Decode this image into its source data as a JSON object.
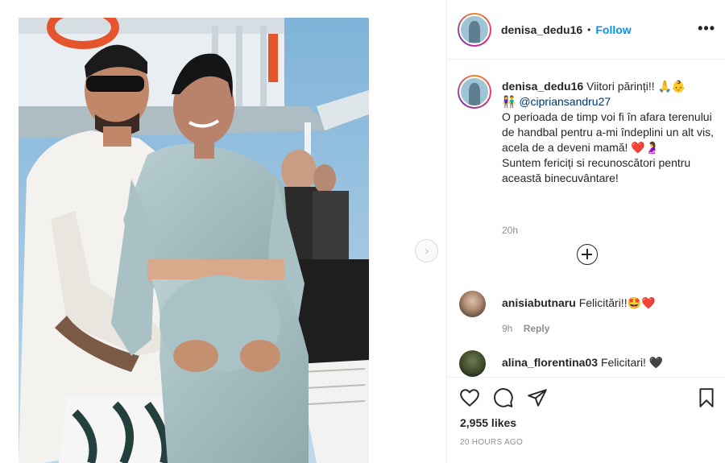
{
  "post": {
    "username": "denisa_dedu16",
    "follow_label": "Follow",
    "separator": "•",
    "more_label": "•••"
  },
  "caption": {
    "username": "denisa_dedu16",
    "line1": "Viitori părinți!! 🙏👶",
    "mention_prefix": "👫 ",
    "mention": "@cipriansandru27",
    "body": "O perioada de timp voi fi în afara terenului de handbal pentru a-mi îndeplini un alt vis, acela de a deveni mamă! ❤️🤰",
    "body2": "Suntem fericiți si recunoscători pentru această binecuvântare!",
    "time": "20h"
  },
  "comments": [
    {
      "username": "anisiabutnaru",
      "text": "Felicitări!!🤩❤️",
      "time": "9h",
      "reply": "Reply"
    },
    {
      "username": "alina_florentina03",
      "text": "Felicitari! 🖤"
    }
  ],
  "actions": {
    "likes": "2,955 likes",
    "timestamp": "20 HOURS AGO"
  },
  "icons": {
    "like": "heart-icon",
    "comment": "comment-icon",
    "share": "paper-plane-icon",
    "save": "bookmark-icon",
    "next": "chevron-right-icon",
    "load_more": "plus-circle-icon",
    "more": "more-options-icon"
  },
  "colors": {
    "link": "#0095f6",
    "mention": "#00376b",
    "muted": "#8e8e8e",
    "text": "#262626"
  }
}
